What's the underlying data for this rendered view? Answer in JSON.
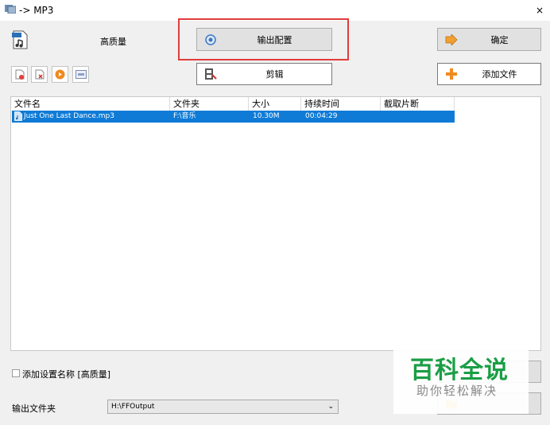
{
  "window": {
    "title": "-> MP3",
    "close": "×"
  },
  "format": {
    "quality_label": "高质量"
  },
  "buttons": {
    "output_config": "输出配置",
    "ok": "确定",
    "clip": "剪辑",
    "add_file": "添加文件"
  },
  "table": {
    "headers": [
      "文件名",
      "文件夹",
      "大小",
      "持续时间",
      "截取片断"
    ],
    "rows": [
      {
        "name": "Just One Last Dance.mp3",
        "folder": "F:\\音乐",
        "size": "10.30M",
        "duration": "00:04:29",
        "clip": ""
      }
    ]
  },
  "options": {
    "add_setting_name": "添加设置名称 [高质量]"
  },
  "output": {
    "label": "输出文件夹",
    "folder": "H:\\FFOutput"
  },
  "watermark": {
    "title": "百科全说",
    "subtitle": "助你轻松解决"
  },
  "colors": {
    "selection": "#0f7bd6",
    "highlight_box": "#e03c3c",
    "watermark_green": "#1a9e45"
  }
}
